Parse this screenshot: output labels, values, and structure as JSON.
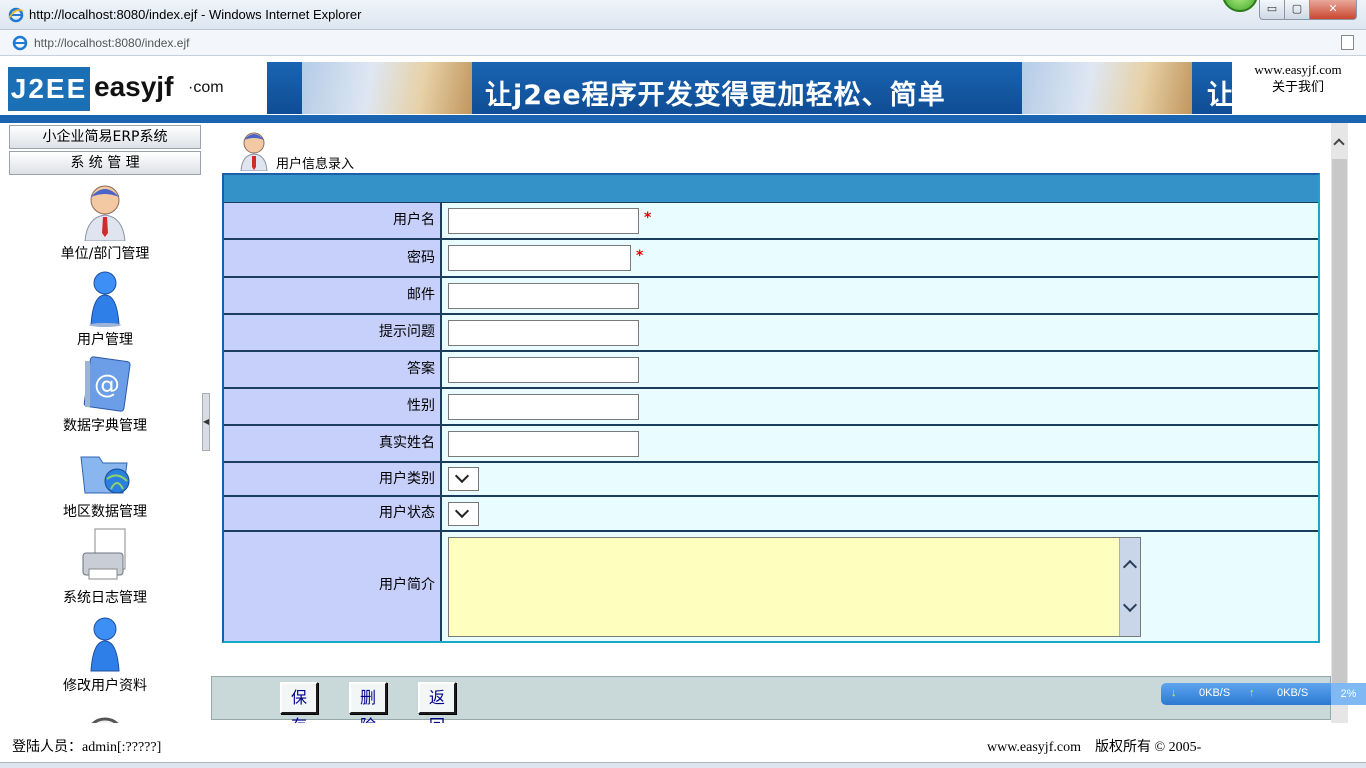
{
  "window": {
    "title": "http://localhost:8080/index.ejf - Windows Internet Explorer",
    "minimize_label": "▭",
    "maximize_label": "▢",
    "close_label": "✕"
  },
  "address_bar": {
    "url": "http://localhost:8080/index.ejf"
  },
  "header": {
    "logo_mark": "J2EE",
    "logo_brand": "easyjf",
    "logo_suffix": "·com",
    "banner_slogan": "让j2ee程序开发变得更加轻松、简单",
    "banner_slogan_cut": "让",
    "site_link": "www.easyjf.com",
    "about_link": "关于我们"
  },
  "sidebar": {
    "tabs": [
      "小企业简易ERP系统",
      "系 统 管 理"
    ],
    "items": [
      {
        "label": "单位/部门管理",
        "icon": "manager-person-icon"
      },
      {
        "label": "用户管理",
        "icon": "user-person-icon"
      },
      {
        "label": "数据字典管理",
        "icon": "address-book-icon"
      },
      {
        "label": "地区数据管理",
        "icon": "globe-folder-icon"
      },
      {
        "label": "系统日志管理",
        "icon": "printer-icon"
      },
      {
        "label": "修改用户资料",
        "icon": "user-person-icon"
      }
    ]
  },
  "form": {
    "title": "用户信息录入",
    "fields": {
      "username": {
        "label": "用户名",
        "value": "",
        "required_mark": "*"
      },
      "password": {
        "label": "密码",
        "value": "",
        "required_mark": "*"
      },
      "email": {
        "label": "邮件",
        "value": ""
      },
      "question": {
        "label": "提示问题",
        "value": ""
      },
      "answer": {
        "label": "答案",
        "value": ""
      },
      "gender": {
        "label": "性别",
        "value": ""
      },
      "realname": {
        "label": "真实姓名",
        "value": ""
      },
      "user_type": {
        "label": "用户类别",
        "value": ""
      },
      "user_status": {
        "label": "用户状态",
        "value": ""
      },
      "intro": {
        "label": "用户简介",
        "value": ""
      }
    }
  },
  "toolbar": {
    "save_label": "保存",
    "delete_label": "删除",
    "back_label": "返回"
  },
  "net_meter": {
    "down_arrow": "↓",
    "down": "0KB/S",
    "up_arrow": "↑",
    "up": "0KB/S",
    "percent": "2%"
  },
  "footer": {
    "login_text": "登陆人员：admin[:?????]",
    "copyright": "www.easyjf.com　版权所有 © 2005-"
  },
  "colors": {
    "form_header": "#3492c8",
    "label_bg": "#c7cffb",
    "value_bg": "#e9fcff",
    "banner": "#1a64b2",
    "required": "#e00000"
  }
}
